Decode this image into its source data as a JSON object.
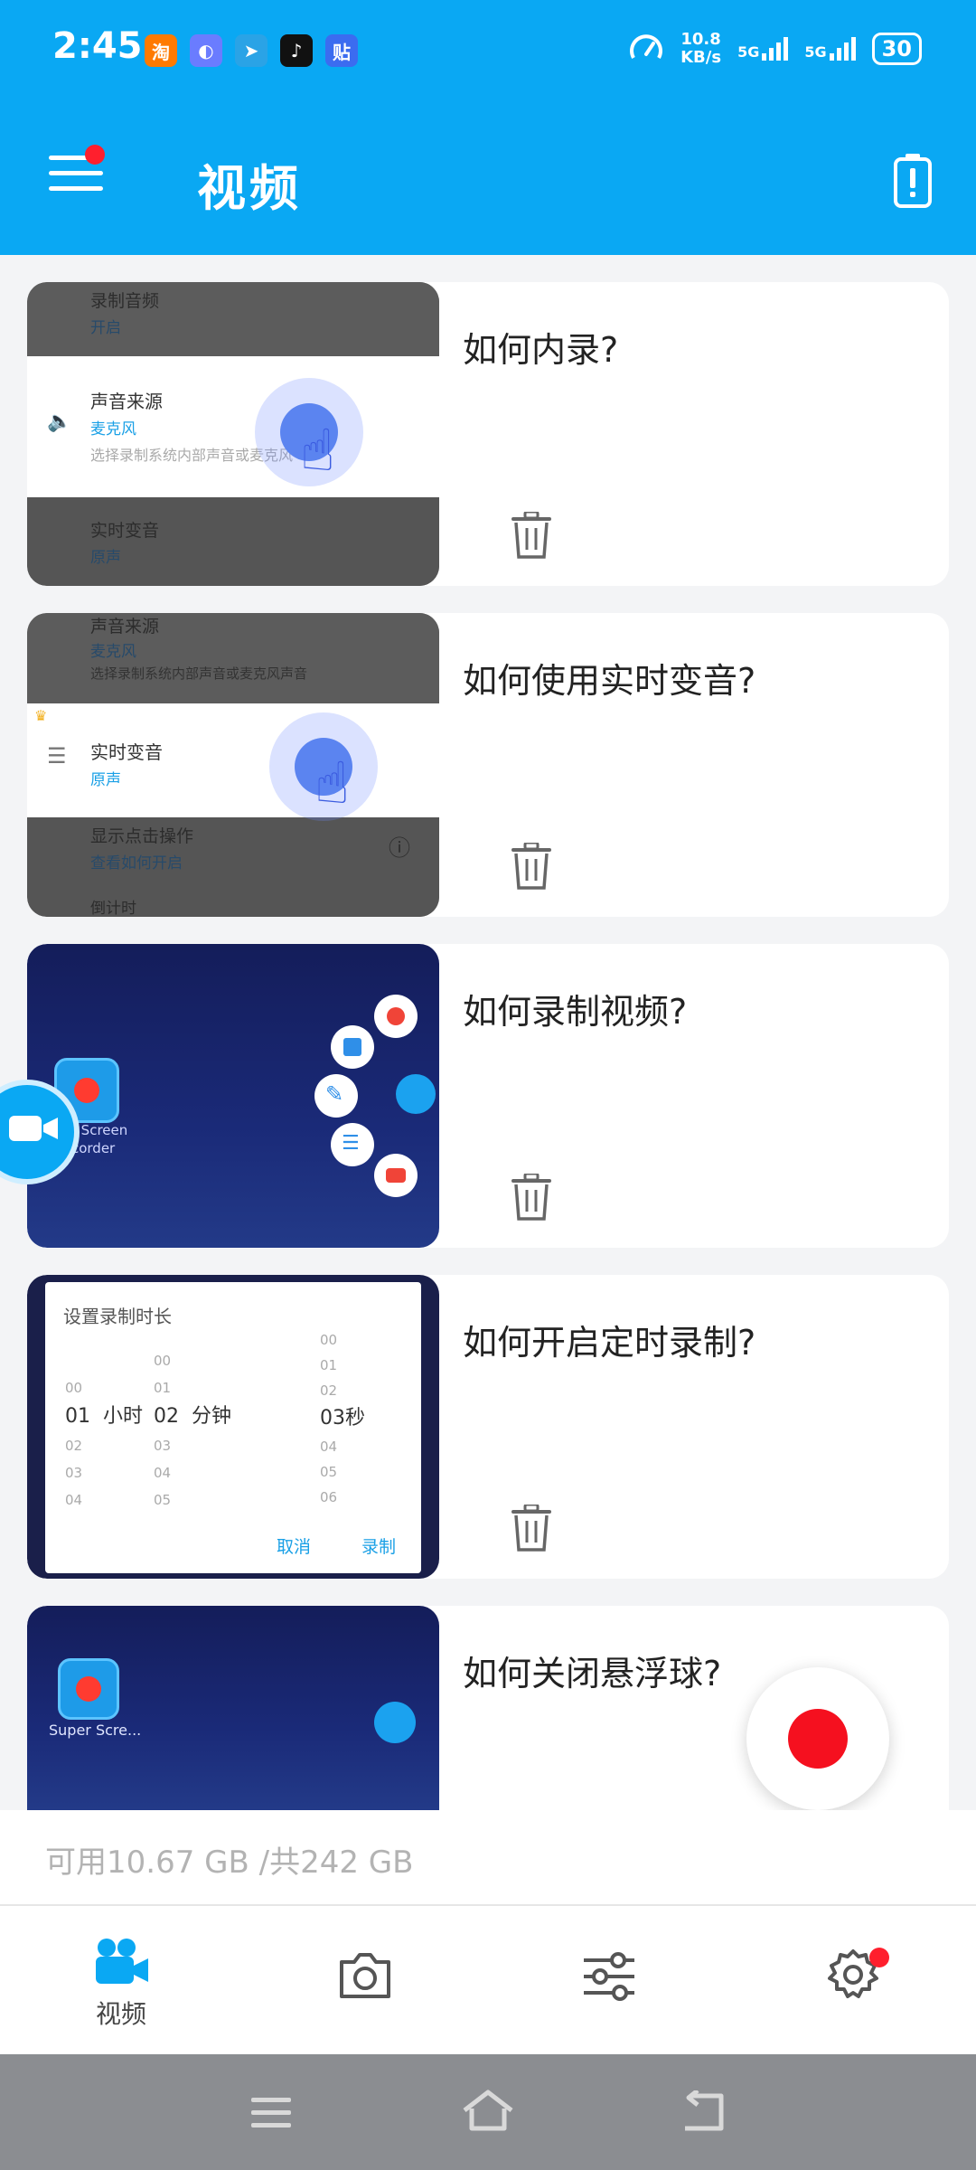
{
  "status_bar": {
    "time": "2:45",
    "notifications": [
      {
        "icon": "taobao-icon",
        "glyph": "淘",
        "color": "#ff7a00"
      },
      {
        "icon": "app-icon",
        "glyph": "◐",
        "color": "#6a7cff"
      },
      {
        "icon": "telegram-icon",
        "glyph": "➤",
        "color": "#2aa3e6"
      },
      {
        "icon": "tiktok-icon",
        "glyph": "♪",
        "color": "#111111"
      },
      {
        "icon": "tieba-icon",
        "glyph": "贴",
        "color": "#3b6cf0"
      }
    ],
    "net_speed_value": "10.8",
    "net_speed_unit": "KB/s",
    "signal1_label": "5G",
    "signal2_label": "5G",
    "battery": "30"
  },
  "header": {
    "title": "视频"
  },
  "videos": [
    {
      "title": "如何内录?",
      "thumb": {
        "row_top_title": "录制音频",
        "row_top_value": "开启",
        "row_mid_title": "声音来源",
        "row_mid_value": "麦克风",
        "row_mid_desc": "选择录制系统内部声音或麦克风",
        "row_bot_title": "实时变音",
        "row_bot_value": "原声"
      }
    },
    {
      "title": "如何使用实时变音?",
      "thumb": {
        "row_top_title": "声音来源",
        "row_top_value": "麦克风",
        "row_top_desc": "选择录制系统内部声音或麦克风声音",
        "row_mid_title": "实时变音",
        "row_mid_value": "原声",
        "row_bot_title": "显示点击操作",
        "row_bot_value": "查看如何开启",
        "row_last_title": "倒计时"
      }
    },
    {
      "title": "如何录制视频?",
      "thumb": {
        "app_label_line1": "per Screen",
        "app_label_line2": "Recorder"
      }
    },
    {
      "title": "如何开启定时录制?",
      "thumb": {
        "dialog_title": "设置录制时长",
        "col_hours": [
          "",
          "00",
          "01",
          "02",
          "03",
          "04"
        ],
        "col_minutes": [
          "00",
          "01",
          "02",
          "03",
          "04",
          "05"
        ],
        "col_seconds": [
          "00",
          "01",
          "02",
          "03",
          "04",
          "05",
          "06"
        ],
        "selected_hours": "01",
        "unit_hours": "小时",
        "selected_minutes": "02",
        "unit_minutes": "分钟",
        "selected_seconds": "03秒",
        "cancel": "取消",
        "confirm": "录制"
      }
    },
    {
      "title": "如何关闭悬浮球?",
      "thumb": {
        "app_label": "Super Scre..."
      }
    }
  ],
  "storage": {
    "text": "可用10.67 GB /共242 GB"
  },
  "bottom_nav": {
    "items": [
      {
        "label": "视频",
        "icon": "video-camera-icon",
        "active": true
      },
      {
        "label": "",
        "icon": "camera-icon"
      },
      {
        "label": "",
        "icon": "sliders-icon"
      },
      {
        "label": "",
        "icon": "gear-icon"
      }
    ]
  },
  "colors": {
    "primary": "#0aa8f3",
    "record": "#f5101f",
    "badge": "#ff1f2d",
    "storage_text": "#b3b3b3"
  }
}
